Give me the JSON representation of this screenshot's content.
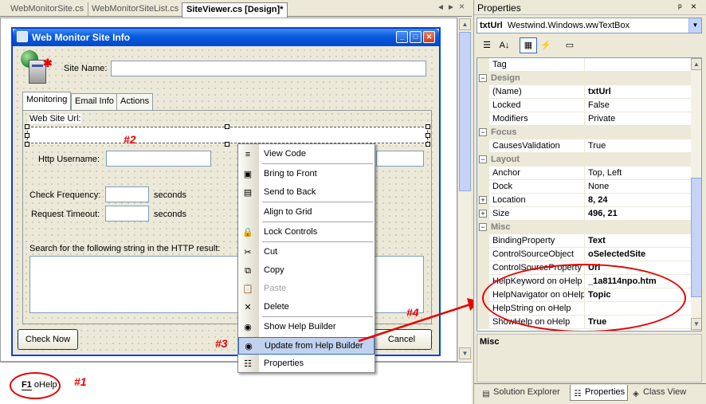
{
  "doc_tabs": [
    "WebMonitorSite.cs",
    "WebMonitorSiteList.cs",
    "SiteViewer.cs [Design]*"
  ],
  "tab_controls": {
    "left": "◄",
    "right": "►",
    "close": "×"
  },
  "form": {
    "title": "Web Monitor Site Info",
    "site_name_label": "Site Name:",
    "tabs": [
      "Monitoring",
      "Email Info",
      "Actions"
    ],
    "web_site_url_label": "Web Site Url:",
    "http_username_label": "Http Username:",
    "check_frequency_label": "Check Frequency:",
    "request_timeout_label": "Request Timeout:",
    "seconds_label_1": "seconds",
    "seconds_label_2": "seconds",
    "search_label": "Search for the following string in the HTTP result:",
    "check_now_button": "Check Now",
    "cancel_button": "Cancel"
  },
  "annotations": {
    "a1": "#1",
    "a2": "#2",
    "a3": "#3",
    "a4": "#4"
  },
  "tray": {
    "component_icon": "F1",
    "component_name": "oHelp"
  },
  "context_menu": [
    {
      "label": "View Code",
      "icon": "view-code-icon",
      "glyph": "≡",
      "disabled": false
    },
    {
      "label": "Bring to Front",
      "icon": "bring-to-front-icon",
      "glyph": "▣",
      "disabled": false
    },
    {
      "label": "Send to Back",
      "icon": "send-to-back-icon",
      "glyph": "▤",
      "disabled": false
    },
    {
      "label": "Align to Grid",
      "icon": "align-to-grid-icon",
      "glyph": "",
      "disabled": false
    },
    {
      "label": "Lock Controls",
      "icon": "lock-icon",
      "glyph": "🔒",
      "disabled": false
    },
    {
      "label": "Cut",
      "icon": "cut-icon",
      "glyph": "✂",
      "disabled": false
    },
    {
      "label": "Copy",
      "icon": "copy-icon",
      "glyph": "⧉",
      "disabled": false
    },
    {
      "label": "Paste",
      "icon": "paste-icon",
      "glyph": "📋",
      "disabled": true
    },
    {
      "label": "Delete",
      "icon": "delete-icon",
      "glyph": "✕",
      "disabled": false
    },
    {
      "label": "Show Help Builder",
      "icon": "help-builder-icon",
      "glyph": "◉",
      "disabled": false
    },
    {
      "label": "Update from Help Builder",
      "icon": "help-builder-icon",
      "glyph": "◉",
      "disabled": false,
      "highlighted": true
    },
    {
      "label": "Properties",
      "icon": "properties-icon",
      "glyph": "☷",
      "disabled": false
    }
  ],
  "properties": {
    "title": "Properties",
    "pin": "ᵖ",
    "close": "×",
    "object_name": "txtUrl",
    "object_type": "Westwind.Windows.wwTextBox",
    "toolbar": [
      {
        "name": "categorized-icon",
        "glyph": "☰"
      },
      {
        "name": "alphabetical-icon",
        "glyph": "A↓"
      },
      {
        "name": "properties-view-icon",
        "glyph": "▦"
      },
      {
        "name": "events-icon",
        "glyph": "⚡"
      },
      {
        "name": "property-pages-icon",
        "glyph": "▭"
      }
    ],
    "rows": [
      {
        "kind": "prop",
        "name": "Tag",
        "value": "",
        "bold": false
      },
      {
        "kind": "cat",
        "name": "Design"
      },
      {
        "kind": "prop",
        "name": "(Name)",
        "value": "txtUrl",
        "bold": true
      },
      {
        "kind": "prop",
        "name": "Locked",
        "value": "False",
        "bold": false
      },
      {
        "kind": "prop",
        "name": "Modifiers",
        "value": "Private",
        "bold": false
      },
      {
        "kind": "cat",
        "name": "Focus"
      },
      {
        "kind": "prop",
        "name": "CausesValidation",
        "value": "True",
        "bold": false
      },
      {
        "kind": "cat",
        "name": "Layout"
      },
      {
        "kind": "prop",
        "name": "Anchor",
        "value": "Top, Left",
        "bold": false
      },
      {
        "kind": "prop",
        "name": "Dock",
        "value": "None",
        "bold": false
      },
      {
        "kind": "prop",
        "name": "Location",
        "value": "8, 24",
        "bold": true,
        "expand": true
      },
      {
        "kind": "prop",
        "name": "Size",
        "value": "496, 21",
        "bold": true,
        "expand": true
      },
      {
        "kind": "cat",
        "name": "Misc"
      },
      {
        "kind": "prop",
        "name": "BindingProperty",
        "value": "Text",
        "bold": true
      },
      {
        "kind": "prop",
        "name": "ControlSourceObject",
        "value": "oSelectedSite",
        "bold": true
      },
      {
        "kind": "prop",
        "name": "ControlSourceProperty",
        "value": "Url",
        "bold": true
      },
      {
        "kind": "prop",
        "name": "HelpKeyword on oHelp",
        "value": "_1a8114npo.htm",
        "bold": true
      },
      {
        "kind": "prop",
        "name": "HelpNavigator on oHelp",
        "value": "Topic",
        "bold": true
      },
      {
        "kind": "prop",
        "name": "HelpString on oHelp",
        "value": "",
        "bold": false
      },
      {
        "kind": "prop",
        "name": "ShowHelp on oHelp",
        "value": "True",
        "bold": true
      }
    ],
    "description_title": "Misc"
  },
  "bottom_tabs": [
    {
      "label": "Solution Explorer",
      "icon": "solution-explorer-icon",
      "glyph": "▤"
    },
    {
      "label": "Properties",
      "icon": "properties-icon",
      "glyph": "☷"
    },
    {
      "label": "Class View",
      "icon": "class-view-icon",
      "glyph": "◈"
    }
  ],
  "colors": {
    "annotation_red": "#e60000",
    "accent_blue": "#316ac5"
  }
}
